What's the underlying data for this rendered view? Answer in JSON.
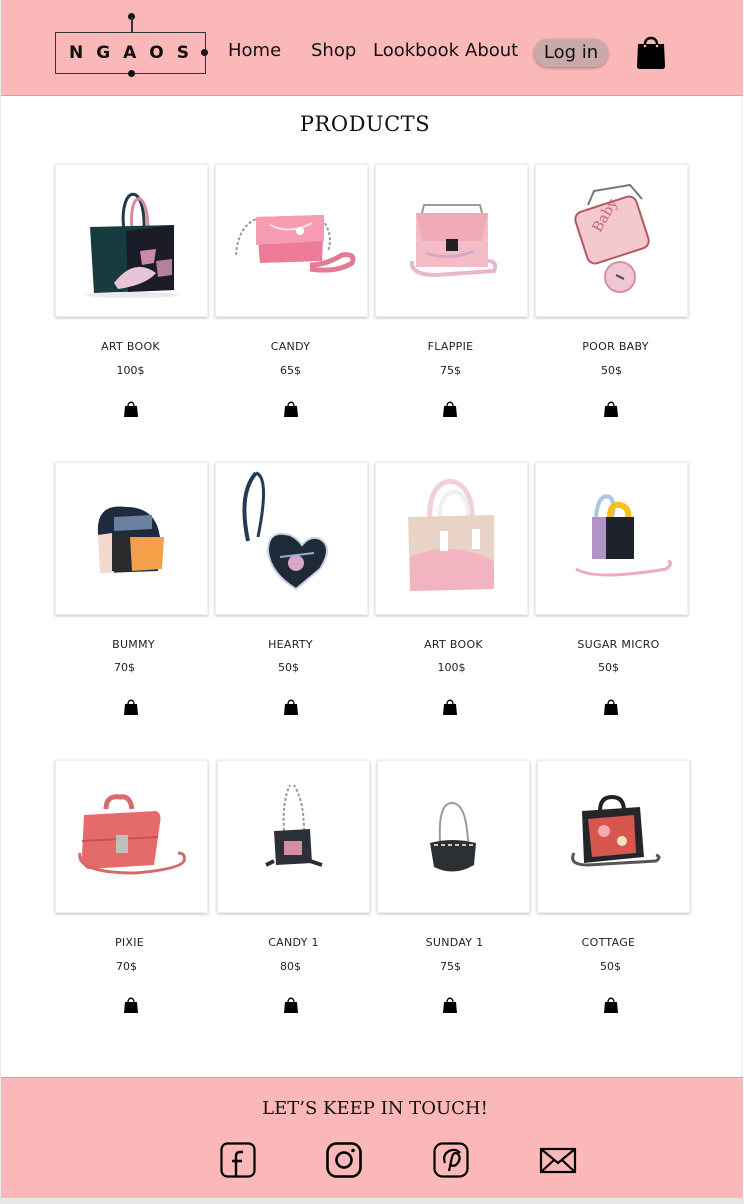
{
  "header": {
    "logo_text": "NGAOS",
    "nav": [
      {
        "label": "Home"
      },
      {
        "label": "Shop"
      },
      {
        "label": "Lookbook"
      },
      {
        "label": "About"
      }
    ],
    "login_label": "Log in",
    "cart_icon": "shopping-bag-icon",
    "background": "#fbb8b8"
  },
  "products": {
    "title": "PRODUCTS",
    "items": [
      {
        "name": "ART BOOK",
        "price": "100$"
      },
      {
        "name": "CANDY",
        "price": "65$"
      },
      {
        "name": "FLAPPIE",
        "price": "75$"
      },
      {
        "name": "POOR BABY",
        "price": "50$"
      },
      {
        "name": "BUMMY",
        "price": "70$"
      },
      {
        "name": "HEARTY",
        "price": "50$"
      },
      {
        "name": "ART BOOK",
        "price": "100$"
      },
      {
        "name": "SUGAR MICRO",
        "price": "50$"
      },
      {
        "name": "PIXIE",
        "price": "70$"
      },
      {
        "name": "CANDY 1",
        "price": "80$"
      },
      {
        "name": "SUNDAY 1",
        "price": "75$"
      },
      {
        "name": "COTTAGE",
        "price": "50$"
      }
    ],
    "add_to_cart_icon": "shopping-bag-icon"
  },
  "footer": {
    "title": "LET’S KEEP IN TOUCH!",
    "social": [
      {
        "icon": "facebook-icon"
      },
      {
        "icon": "instagram-icon"
      },
      {
        "icon": "pinterest-icon"
      },
      {
        "icon": "mail-icon"
      }
    ]
  }
}
